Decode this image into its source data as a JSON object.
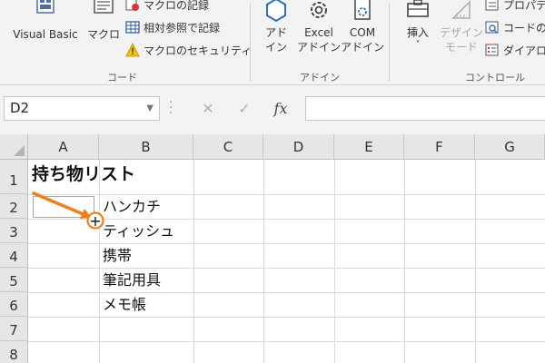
{
  "ribbon": {
    "code_group": {
      "label": "コード",
      "visual_basic": "Visual Basic",
      "macro": "マクロ",
      "record_macro": "マクロの記録",
      "relative_ref": "相対参照で記録",
      "macro_security": "マクロのセキュリティ"
    },
    "addin_group": {
      "label": "アドイン",
      "addin_l1": "アド",
      "addin_l2": "イン",
      "excel_addin_l1": "Excel",
      "excel_addin_l2": "アドイン",
      "com_addin_l1": "COM",
      "com_addin_l2": "アドイン"
    },
    "control_group": {
      "label": "コントロール",
      "insert": "挿入",
      "insert_arrow": "˅",
      "design_mode_l1": "デザイン",
      "design_mode_l2": "モード",
      "properties": "プロパティ",
      "view_code": "コードの表",
      "dialog": "ダイアログ"
    }
  },
  "formula_bar": {
    "name_box": "D2",
    "fx": "fx",
    "cancel": "✕",
    "enter": "✓",
    "formula": ""
  },
  "grid": {
    "columns": [
      "A",
      "B",
      "C",
      "D",
      "E",
      "F",
      "G"
    ],
    "rows": [
      "1",
      "2",
      "3",
      "4",
      "5",
      "6",
      "7",
      "8"
    ],
    "cells": {
      "A1": "持ち物リスト",
      "B2": "ハンカチ",
      "B3": "ティッシュ",
      "B4": "携帯",
      "B5": "筆記用具",
      "B6": "メモ帳"
    }
  },
  "annotation": {
    "color": "#f07d1e",
    "fill_handle_symbol": "+"
  }
}
